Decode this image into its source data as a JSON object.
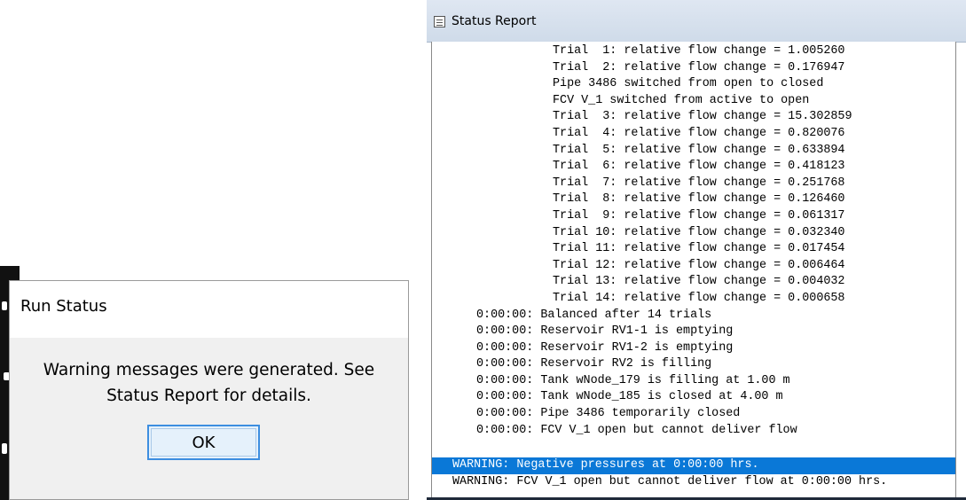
{
  "run_status": {
    "title": "Run Status",
    "message_line1": "Warning messages were generated. See",
    "message_line2": "Status Report for details.",
    "ok_label": "OK"
  },
  "status_report": {
    "title": "Status Report",
    "trials": [
      "Trial  1: relative flow change = 1.005260",
      "Trial  2: relative flow change = 0.176947",
      "Pipe 3486 switched from open to closed",
      "FCV V_1 switched from active to open",
      "Trial  3: relative flow change = 15.302859",
      "Trial  4: relative flow change = 0.820076",
      "Trial  5: relative flow change = 0.633894",
      "Trial  6: relative flow change = 0.418123",
      "Trial  7: relative flow change = 0.251768",
      "Trial  8: relative flow change = 0.126460",
      "Trial  9: relative flow change = 0.061317",
      "Trial 10: relative flow change = 0.032340",
      "Trial 11: relative flow change = 0.017454",
      "Trial 12: relative flow change = 0.006464",
      "Trial 13: relative flow change = 0.004032",
      "Trial 14: relative flow change = 0.000658"
    ],
    "events": [
      "0:00:00: Balanced after 14 trials",
      "0:00:00: Reservoir RV1-1 is emptying",
      "0:00:00: Reservoir RV1-2 is emptying",
      "0:00:00: Reservoir RV2 is filling",
      "0:00:00: Tank wNode_179 is filling at 1.00 m",
      "0:00:00: Tank wNode_185 is closed at 4.00 m",
      "0:00:00: Pipe 3486 temporarily closed",
      "0:00:00: FCV V_1 open but cannot deliver flow"
    ],
    "warnings": [
      "WARNING: Negative pressures at 0:00:00 hrs.",
      "WARNING: FCV V_1 open but cannot deliver flow at 0:00:00 hrs."
    ],
    "selected_warning_index": 0,
    "selection_color": "#0a78d7"
  }
}
